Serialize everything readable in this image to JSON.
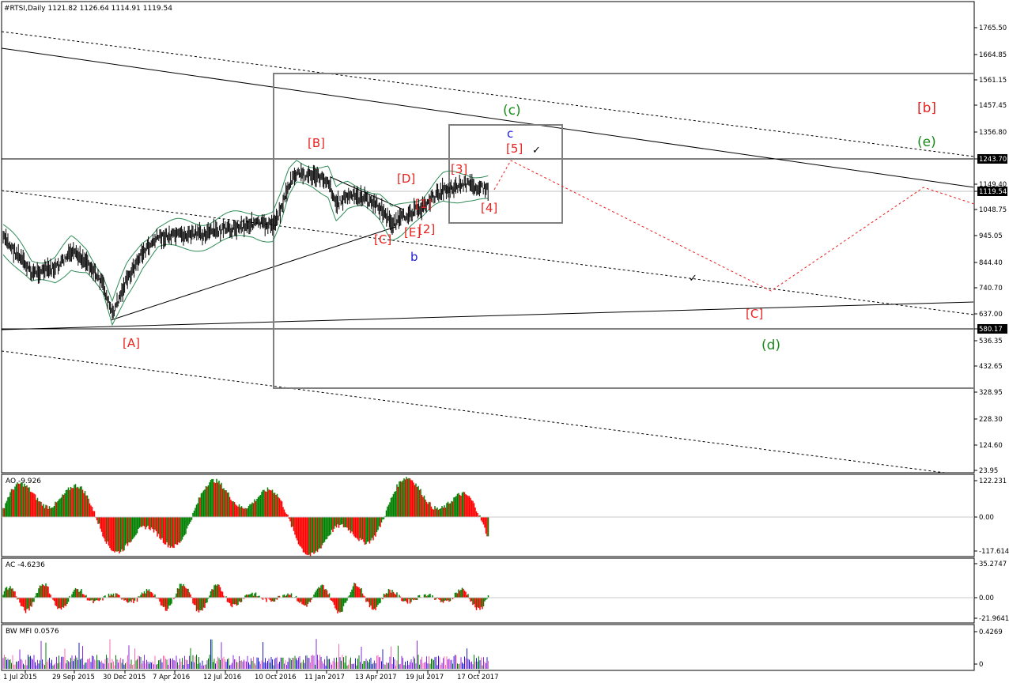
{
  "window": {
    "main_title": "#RTSI,Daily  1121.82 1126.64 1114.91 1119.54",
    "ao_title": "AO -9.926",
    "ac_title": "AC -4.6236",
    "mfi_title": "BW MFI 0.0576"
  },
  "price_axis": {
    "ticks": [
      "1765.50",
      "1664.85",
      "1561.15",
      "1457.45",
      "1356.80",
      "1243.70",
      "1149.40",
      "1119.54",
      "1048.75",
      "945.05",
      "844.40",
      "740.70",
      "637.00",
      "580.17",
      "536.35",
      "432.65",
      "328.95",
      "228.30",
      "124.60",
      "23.95"
    ],
    "highlight_current": "1119.54",
    "highlight_line_1": "1243.70",
    "highlight_line_2": "580.17"
  },
  "ao_axis": {
    "ticks": [
      "122.231",
      "0.00",
      "-117.614"
    ]
  },
  "ac_axis": {
    "ticks": [
      "35.2747",
      "0.00",
      "-21.9641"
    ]
  },
  "mfi_axis": {
    "ticks": [
      "0.4269",
      "0"
    ]
  },
  "time_axis": {
    "labels": [
      "1 Jul 2015",
      "29 Sep 2015",
      "30 Dec 2015",
      "7 Apr 2016",
      "12 Jul 2016",
      "10 Oct 2016",
      "11 Jan 2017",
      "13 Apr 2017",
      "19 Jul 2017",
      "17 Oct 2017"
    ]
  },
  "wave_labels": {
    "A": "[A]",
    "B": "[B]",
    "C_low": "[C]",
    "D": "[D]",
    "E": "[E]",
    "w1": "[1]",
    "w2": "[2]",
    "w3": "[3]",
    "w4": "[4]",
    "w5": "[5]",
    "b_blue": "b",
    "c_blue": "c",
    "c_green": "(c)",
    "d_green": "(d)",
    "e_green": "(e)",
    "b_red_bracket": "[b]",
    "C_future": "[C]",
    "check_1": "✓",
    "check_2": "✓"
  },
  "colors": {
    "red": "#e8231f",
    "green": "#1a8a1a",
    "blue": "#1b1bd8",
    "bull": "#008000",
    "bear": "#ff0000",
    "bands": "#2e8b57"
  }
}
